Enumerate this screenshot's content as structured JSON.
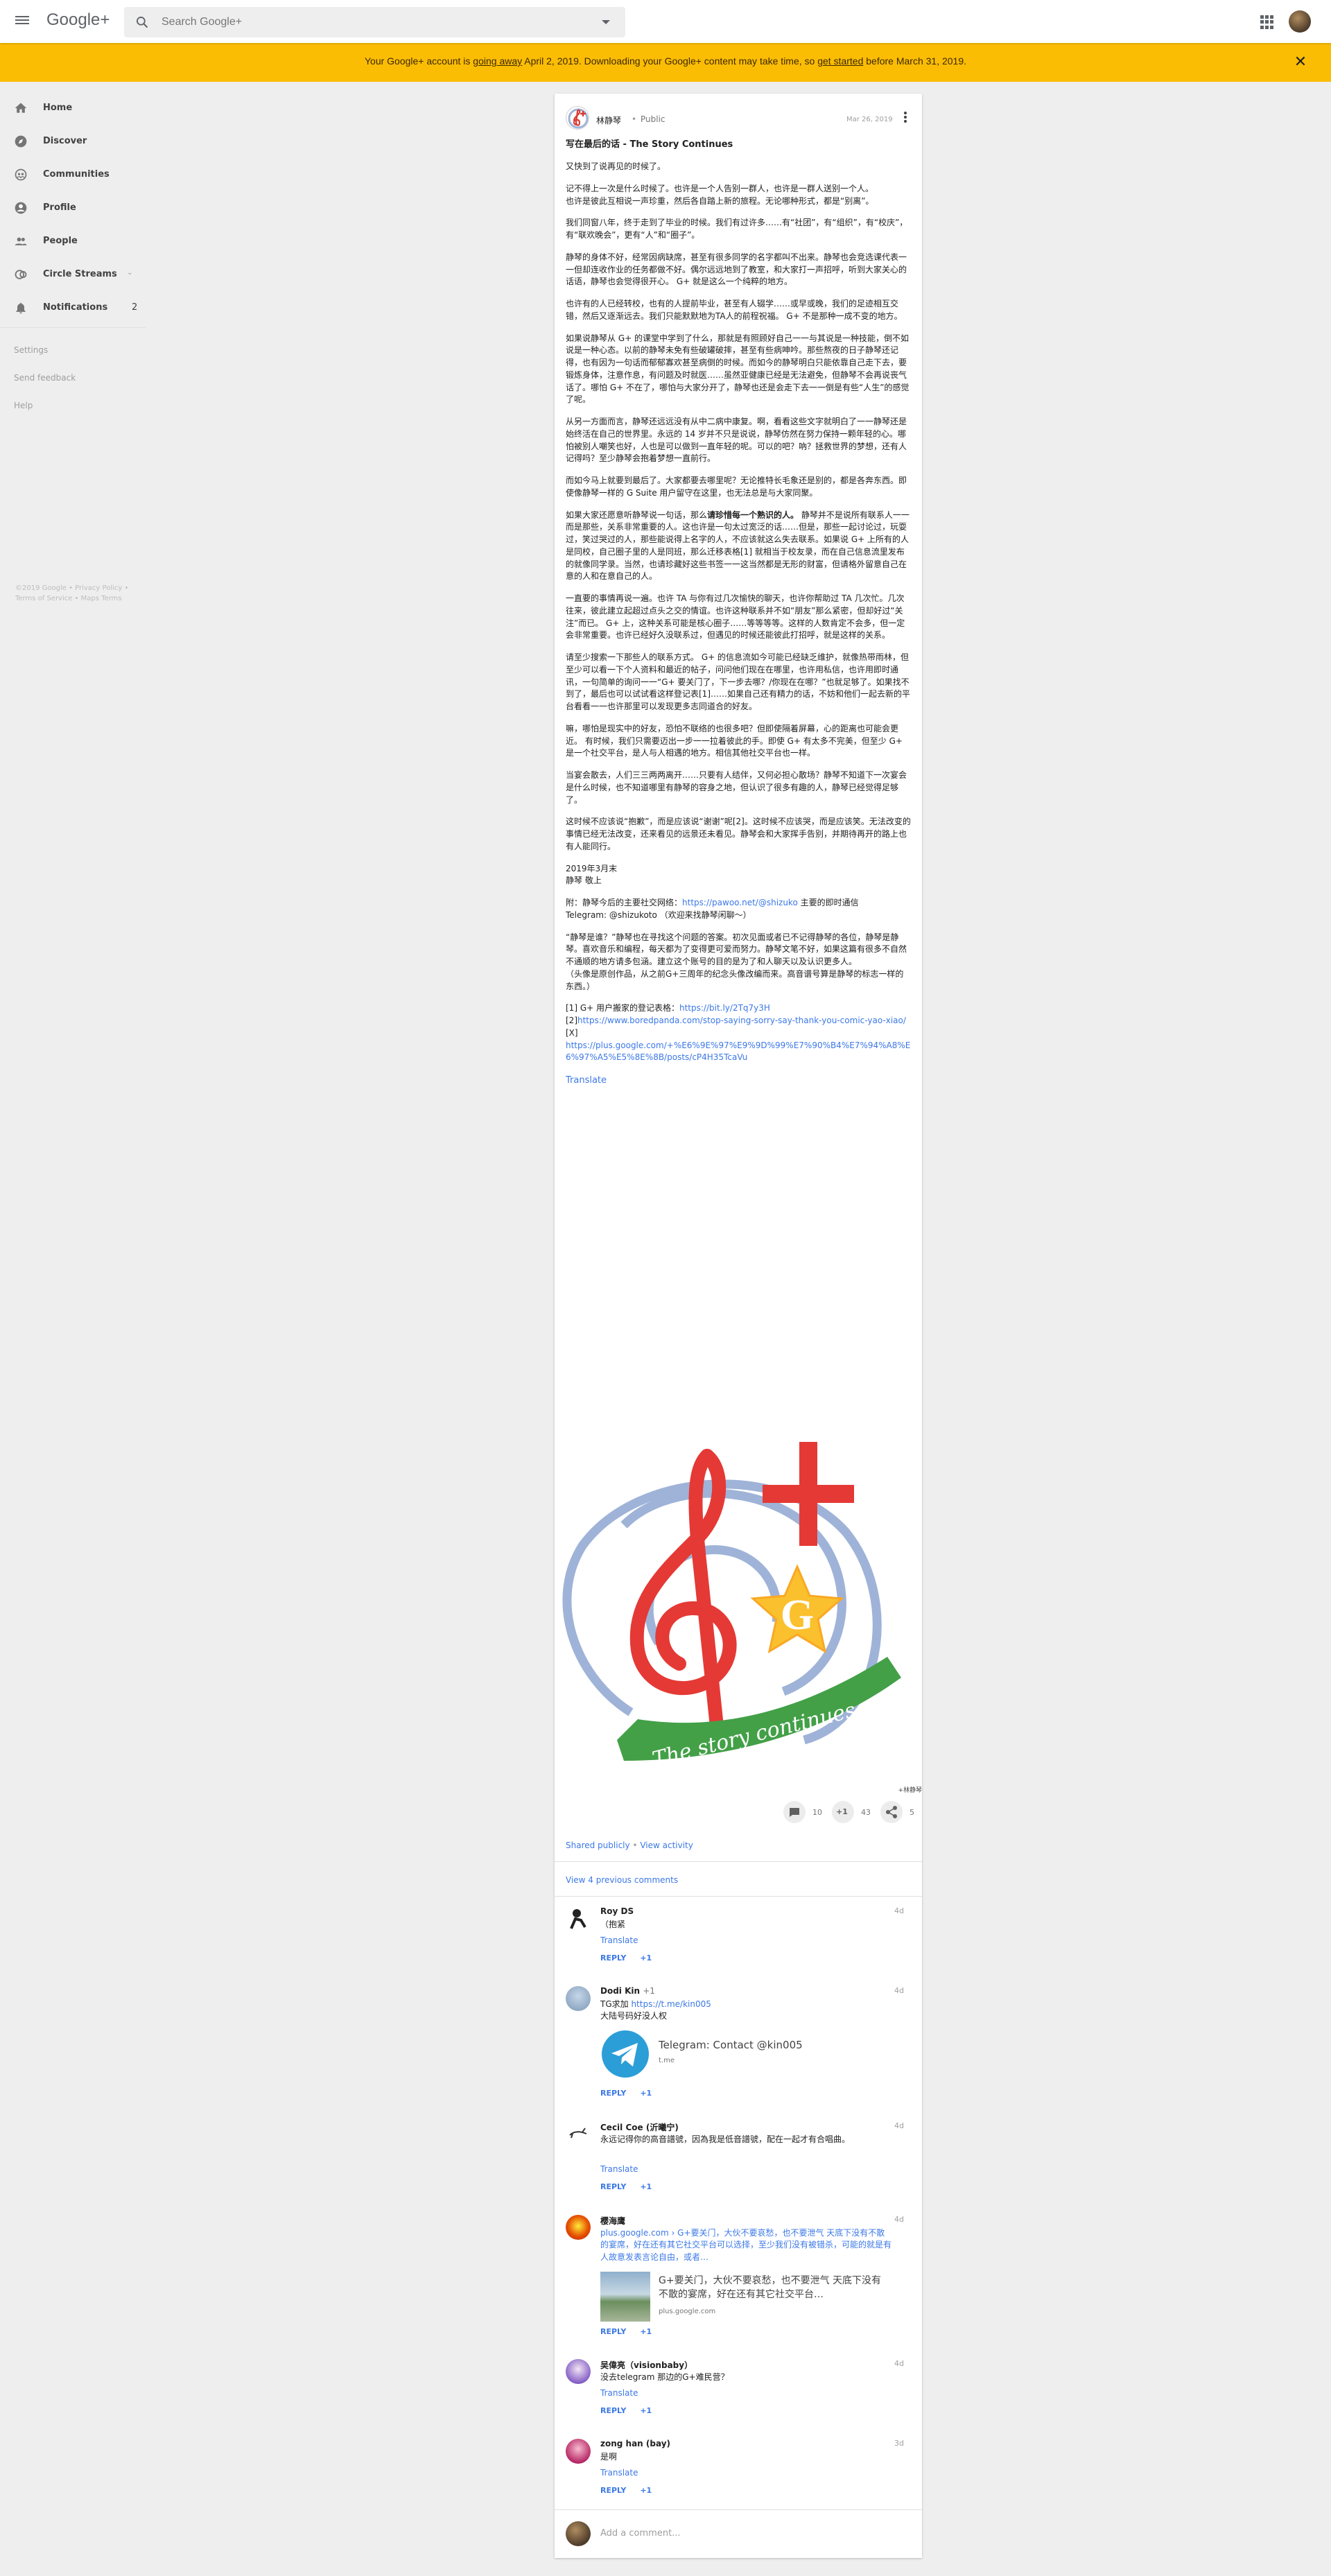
{
  "header": {
    "logo": "Google+",
    "search_placeholder": "Search Google+"
  },
  "banner": {
    "text_1": "Your Google+ account is ",
    "link_1": "going away",
    "text_2": " April 2, 2019. Downloading your Google+ content may take time, so ",
    "link_2": "get started",
    "text_3": " before March 31, 2019."
  },
  "sidebar": {
    "items": [
      {
        "label": "Home",
        "icon": "home-icon"
      },
      {
        "label": "Discover",
        "icon": "compass-icon"
      },
      {
        "label": "Communities",
        "icon": "communities-icon"
      },
      {
        "label": "Profile",
        "icon": "profile-icon"
      },
      {
        "label": "People",
        "icon": "people-icon"
      },
      {
        "label": "Circle Streams",
        "icon": "circles-icon"
      },
      {
        "label": "Notifications",
        "icon": "bell-icon",
        "count": "2"
      }
    ],
    "links": [
      "Settings",
      "Send feedback",
      "Help"
    ],
    "footer_1": "©2019 Google • Privacy Policy •",
    "footer_2": "Terms of Service • Maps Terms"
  },
  "post": {
    "author": "林静琴",
    "visibility": "Public",
    "date": "Mar 26, 2019",
    "title": "写在最后的话 - The Story Continues",
    "paragraphs": [
      "又快到了说再见的时候了。",
      "记不得上一次是什么时候了。也许是一个人告别一群人，也许是一群人送别一个人。\n也许是彼此互相说一声珍重，然后各自踏上新的旅程。无论哪种形式，都是“别离”。",
      "我们同窗八年，终于走到了毕业的时候。我们有过许多……有“社团”，有“组织”，有“校庆”，有“联欢晚会”，更有“人”和“圈子”。",
      "静琴的身体不好，经常因病缺席，甚至有很多同学的名字都叫不出来。静琴也会竞选课代表一一但却连收作业的任务都做不好。偶尔远远地到了教室，和大家打一声招呼，听到大家关心的话语，静琴也会觉得很开心。 G+ 就是这么一个纯粹的地方。",
      "也许有的人已经转校，也有的人提前毕业，甚至有人辍学……或早或晚，我们的足迹相互交错，然后又逐渐远去。我们只能默默地为TA人的前程祝福。 G+ 不是那种一成不变的地方。",
      "如果说静琴从 G+ 的课堂中学到了什么，那就是有照顾好自己一一与其说是一种技能，倒不如说是一种心态。以前的静琴未免有些破罐破摔，甚至有些病呻吟。那些熬夜的日子静琴还记得，也有因为一句话而郁郁寡欢甚至病倒的时候。而如今的静琴明白只能依靠自己走下去，要锻炼身体，注意作息，有问题及时就医……虽然亚健康已经是无法避免，但静琴不会再说丧气话了。哪怕 G+ 不在了，哪怕与大家分开了，静琴也还是会走下去一一倒是有些“人生”的感觉了呢。",
      "从另一方面而言，静琴还远远没有从中二病中康复。啊，看看这些文字就明白了一一静琴还是始终活在自己的世界里。永远的 14 岁并不只是说说，静琴仿然在努力保持一颗年轻的心。哪怕被别人嘲笑也好，人也是可以做到一直年轻的呢。可以的吧？吶？拯救世界的梦想，还有人记得吗？至少静琴会抱着梦想一直前行。",
      "而如今马上就要到最后了。大家都要去哪里呢？无论推特长毛象还是别的，都是各奔东西。即使像静琴一样的 G Suite 用户留守在这里，也无法总是与大家同聚。",
      "__BOLD_PARA__",
      "一直要的事情再说一遍。也许 TA 与你有过几次愉快的聊天，也许你帮助过 TA 几次忙。几次往来，彼此建立起超过点头之交的情谊。也许这种联系并不如“朋友”那么紧密，但却好过“关注”而已。 G+ 上，这种关系可能是核心圈子……等等等等。这样的人数肯定不会多，但一定会非常重要。也许已经好久没联系过，但遇见的时候还能彼此打招呼，就是这样的关系。",
      "请至少搜索一下那些人的联系方式。 G+ 的信息流如今可能已经缺乏维护，就像热带雨林，但至少可以看一下个人资料和最近的帖子，问问他们现在在哪里，也许用私信，也许用即时通讯，一句简单的询问一一“G+ 要关门了，下一步去哪？/你现在在哪？”也就足够了。如果找不到了，最后也可以试试看这样登记表[1]……如果自己还有精力的话，不妨和他们一起去新的平台看看一一也许那里可以发现更多志同道合的好友。",
      "嘛，哪怕是现实中的好友，恐怕不联络的也很多吧？但即使隔着屏幕，心的距离也可能会更近。 有时候，我们只需要迈出一步一一拉着彼此的手。即使 G+ 有太多不完美，但至少 G+ 是一个社交平台，是人与人相遇的地方。相信其他社交平台也一样。",
      "当宴会散去，人们三三两两离开……只要有人结伴，又何必担心散场？静琴不知道下一次宴会是什么时候，也不知道哪里有静琴的容身之地，但认识了很多有趣的人，静琴已经觉得足够了。",
      "这时候不应该说“抱歉”，而是应该说“谢谢”呢[2]。这时候不应该哭，而是应该笑。无法改变的事情已经无法改变，还来看见的远景还未看见。静琴会和大家挥手告别，并期待再开的路上也有人能同行。",
      "2019年3月末\n静琴 敬上"
    ],
    "bold_intro": "如果大家还愿意听静琴说一句话，那么",
    "bold_text": "请珍惜每一个熟识的人。",
    "bold_rest": " 静琴并不是说所有联系人一一而是那些，关系非常重要的人。这也许是一句太过宽泛的话……但是，那些一起讨论过，玩耍过，笑过哭过的人，那些能说得上名字的人，不应该就这么失去联系。如果说 G+ 上所有的人是同校，自己圈子里的人是同班，那么迁移表格[1] 就相当于校友录，而在自己信息流里发布的就像同学录。当然，也请珍藏好这些书签一一这当然都是无形的财富，但请格外留意自己在意的人和在意自己的人。",
    "contact_line_1": "附：静琴今后的主要社交网络：",
    "contact_link": "https://pawoo.net/@shizuko",
    "contact_line_1b": " 主要的即时通信",
    "contact_line_2": "Telegram: @shizukoto （欢迎来找静琴闲聊～）",
    "about_paragraph": "“静琴是谁？”静琴也在寻找这个问题的答案。初次见面或者已不记得静琴的各位，静琴是静琴。喜欢音乐和编程，每天都为了变得更可爱而努力。静琴文笔不好，如果这篇有很多不自然不通顺的地方请多包涵。建立这个账号的目的是为了和人聊天以及认识更多人。\n（头像是原创作品，从之前G+三周年的纪念头像改编而来。高音谱号算是静琴的标志一样的东西。）",
    "ref_1_label": "[1] G+ 用户搬家的登记表格：",
    "ref_1_link": "https://bit.ly/2Tq7y3H",
    "ref_2_label": "[2]",
    "ref_2_link": "https://www.boredpanda.com/stop-saying-sorry-say-thank-you-comic-yao-xiao/",
    "ref_x_label": "[X]",
    "ref_x_link": "https://plus.google.com/+%E6%9E%97%E9%9D%99%E7%90%B4%E7%94%A8%E6%97%A5%E5%8E%8B/posts/cP4H35TcaVu",
    "translate": "Translate",
    "image_caption": "The story continues",
    "image_credit": "+林静琴",
    "actions": {
      "comments": "10",
      "plus_label": "+1",
      "plus_count": "43",
      "shares": "5"
    },
    "shared_publicly": "Shared publicly",
    "view_activity": "View activity",
    "prev_comments": "View 4 previous comments"
  },
  "comments": [
    {
      "name": "Roy DS",
      "time": "4d",
      "text": "（抱紧",
      "translate": "Translate"
    },
    {
      "name": "Dodi Kin",
      "badge": "+1",
      "time": "4d",
      "text_prefix": "TG求加 ",
      "text_link": "https://t.me/kin005",
      "text_2": "大陆号码好没人权",
      "preview_title": "Telegram: Contact @kin005",
      "preview_domain": "t.me"
    },
    {
      "name": "Cecil Coe (沂曦宁)",
      "time": "4d",
      "text": "永远记得你的高音譜號，因為我是低音譜號，配在一起才有合唱曲。",
      "translate": "Translate"
    },
    {
      "name": "樱海鹰",
      "time": "4d",
      "link_text": "plus.google.com › G+要关门，大伙不要哀愁，也不要泄气 天底下没有不散的宴席，好在还有其它社交平台可以选择，至少我们没有被错杀，可能的就是有人故意发表言论自由，或者…",
      "preview_title": "G+要关门，大伙不要哀愁，也不要泄气 天底下没有不散的宴席，好在还有其它社交平台…",
      "preview_domain": "plus.google.com"
    },
    {
      "name": "吴偉亮（visionbaby）",
      "time": "4d",
      "text": "没去telegram 那边的G+难民营？",
      "translate": "Translate"
    },
    {
      "name": "zong han (bay)",
      "time": "3d",
      "text": "是啊",
      "translate": "Translate"
    }
  ],
  "comment_actions": {
    "reply": "REPLY",
    "plus": "+1"
  },
  "add_comment_placeholder": "Add a comment...",
  "colors": {
    "banner": "#fbbc04",
    "link": "#3b78e7",
    "accent_red": "#e53935"
  }
}
